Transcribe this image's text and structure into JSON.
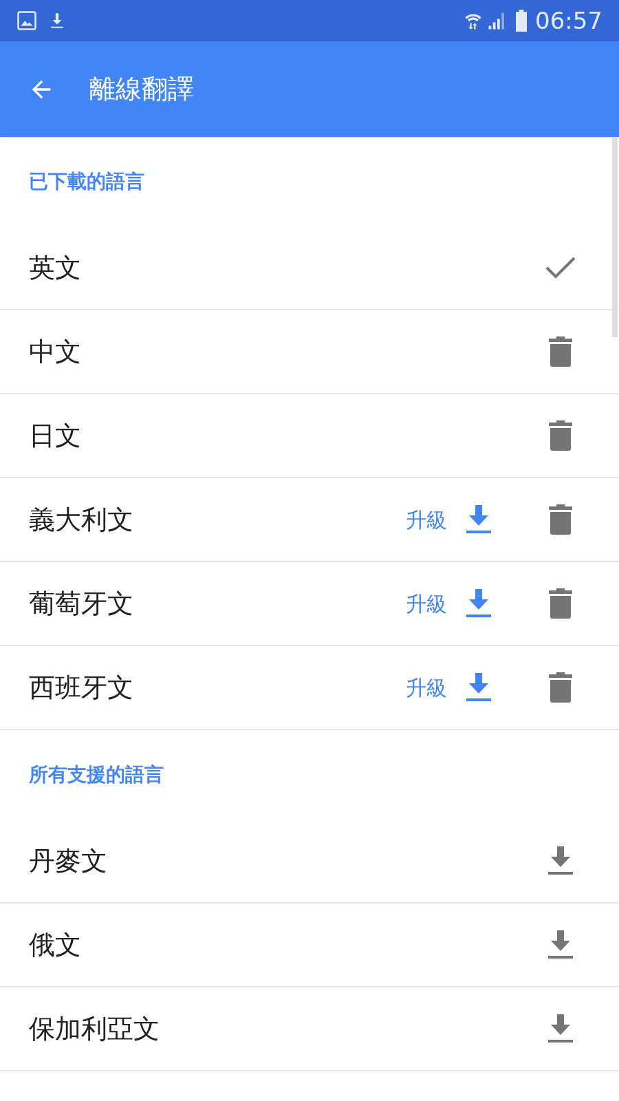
{
  "status_bar": {
    "time": "06:57"
  },
  "app_bar": {
    "title": "離線翻譯"
  },
  "sections": [
    {
      "header": "已下載的語言",
      "rows": [
        {
          "name": "英文",
          "kind": "current"
        },
        {
          "name": "中文",
          "kind": "downloaded"
        },
        {
          "name": "日文",
          "kind": "downloaded"
        },
        {
          "name": "義大利文",
          "kind": "downloaded",
          "upgrade": "升級"
        },
        {
          "name": "葡萄牙文",
          "kind": "downloaded",
          "upgrade": "升級"
        },
        {
          "name": "西班牙文",
          "kind": "downloaded",
          "upgrade": "升級"
        }
      ]
    },
    {
      "header": "所有支援的語言",
      "rows": [
        {
          "name": "丹麥文",
          "kind": "available"
        },
        {
          "name": "俄文",
          "kind": "available"
        },
        {
          "name": "保加利亞文",
          "kind": "available"
        }
      ]
    }
  ]
}
